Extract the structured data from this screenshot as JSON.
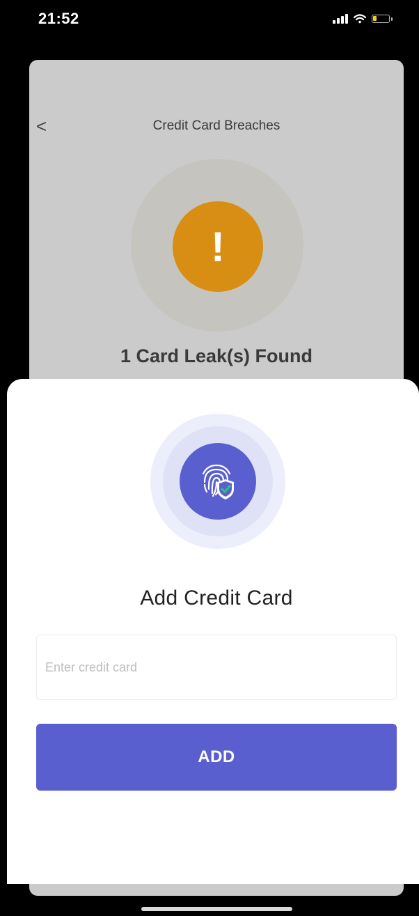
{
  "status_bar": {
    "time": "21:52",
    "icons": [
      "cellular-signal-icon",
      "wifi-icon",
      "battery-low-icon"
    ]
  },
  "background_page": {
    "back_icon": "chevron-left-icon",
    "back_glyph": "<",
    "title": "Credit Card Breaches",
    "alert_icon": "exclamation-icon",
    "alert_glyph": "!",
    "leak_summary": "1 Card Leak(s) Found"
  },
  "sheet": {
    "icon": "fingerprint-shield-check-icon",
    "title": "Add Credit Card",
    "input": {
      "value": "",
      "placeholder": "Enter credit card"
    },
    "add_button_label": "ADD"
  },
  "colors": {
    "accent": "#5A5FCF",
    "warning": "#D88E12",
    "check": "#2EC27E"
  }
}
